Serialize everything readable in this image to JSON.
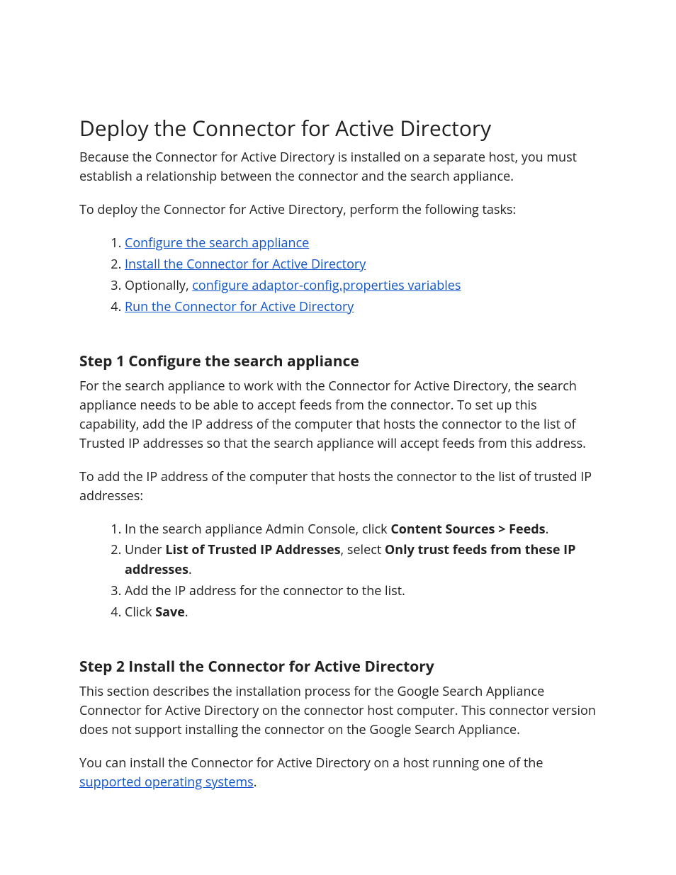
{
  "title": "Deploy the Connector for Active Directory",
  "intro1": "Because the Connector for Active Directory is installed on a separate host, you must establish a relationship between the connector and the search appliance.",
  "intro2": "To deploy the Connector for Active Directory, perform the following tasks:",
  "tasks": {
    "item1": "Configure the search appliance",
    "item2": "Install the Connector for Active Directory",
    "item3_prefix": "Optionally, ",
    "item3_link": "configure adaptor-config.properties variables",
    "item4": "Run the Connector for Active Directory"
  },
  "step1": {
    "heading": "Step 1 Configure the search appliance",
    "para1": "For the search appliance to work with the Connector for Active Directory, the search appliance needs to be able to accept feeds from the connector. To set up this capability, add the IP address of the computer that hosts the connector to the list of Trusted IP addresses so that the search appliance will accept feeds from this address.",
    "para2": "To add the IP address of the computer that hosts the connector to the list of trusted IP addresses:",
    "ol": {
      "i1_a": "In the search appliance Admin Console, click ",
      "i1_b": "Content Sources > Feeds",
      "i1_c": ".",
      "i2_a": "Under ",
      "i2_b": "List of Trusted IP Addresses",
      "i2_c": ", select ",
      "i2_d": "Only trust feeds from these IP addresses",
      "i2_e": ".",
      "i3": "Add the IP address for the connector to the list.",
      "i4_a": "Click ",
      "i4_b": "Save",
      "i4_c": "."
    }
  },
  "step2": {
    "heading": "Step 2 Install the Connector for Active Directory",
    "para1": "This section describes the installation process for the Google Search Appliance Connector for Active Directory on the connector host computer. This connector version does not support installing the connector on the Google Search Appliance.",
    "para2_a": "You can install the Connector for Active Directory on a host running one of the ",
    "para2_link": "supported operating systems",
    "para2_b": "."
  }
}
